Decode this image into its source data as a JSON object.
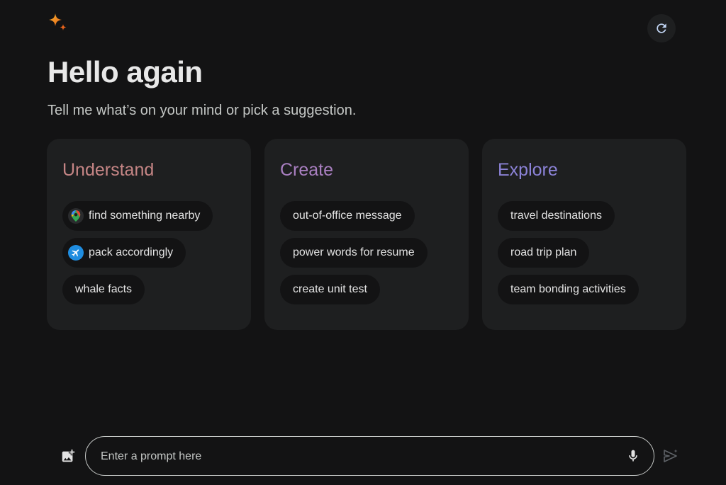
{
  "header": {
    "greeting": "Hello again",
    "subtitle": "Tell me what’s on your mind or pick a suggestion.",
    "logo_icon": "sparkle-icon",
    "refresh_icon": "refresh-icon"
  },
  "cards": [
    {
      "title": "Understand",
      "title_color": "#c58585",
      "chips": [
        {
          "label": "find something nearby",
          "icon": "maps-pin-icon"
        },
        {
          "label": "pack accordingly",
          "icon": "flight-icon"
        },
        {
          "label": "whale facts",
          "icon": ""
        }
      ]
    },
    {
      "title": "Create",
      "title_color": "#a97fc1",
      "chips": [
        {
          "label": "out-of-office message",
          "icon": ""
        },
        {
          "label": "power words for resume",
          "icon": ""
        },
        {
          "label": "create unit test",
          "icon": ""
        }
      ]
    },
    {
      "title": "Explore",
      "title_color": "#8b82d6",
      "chips": [
        {
          "label": "travel destinations",
          "icon": ""
        },
        {
          "label": "road trip plan",
          "icon": ""
        },
        {
          "label": "team bonding activities",
          "icon": ""
        }
      ]
    }
  ],
  "prompt": {
    "placeholder": "Enter a prompt here",
    "value": "",
    "image_icon": "add-image-icon",
    "mic_icon": "microphone-icon",
    "send_icon": "send-icon"
  },
  "colors": {
    "background": "#131314",
    "card": "#1e1f20",
    "text": "#e3e3e3"
  }
}
